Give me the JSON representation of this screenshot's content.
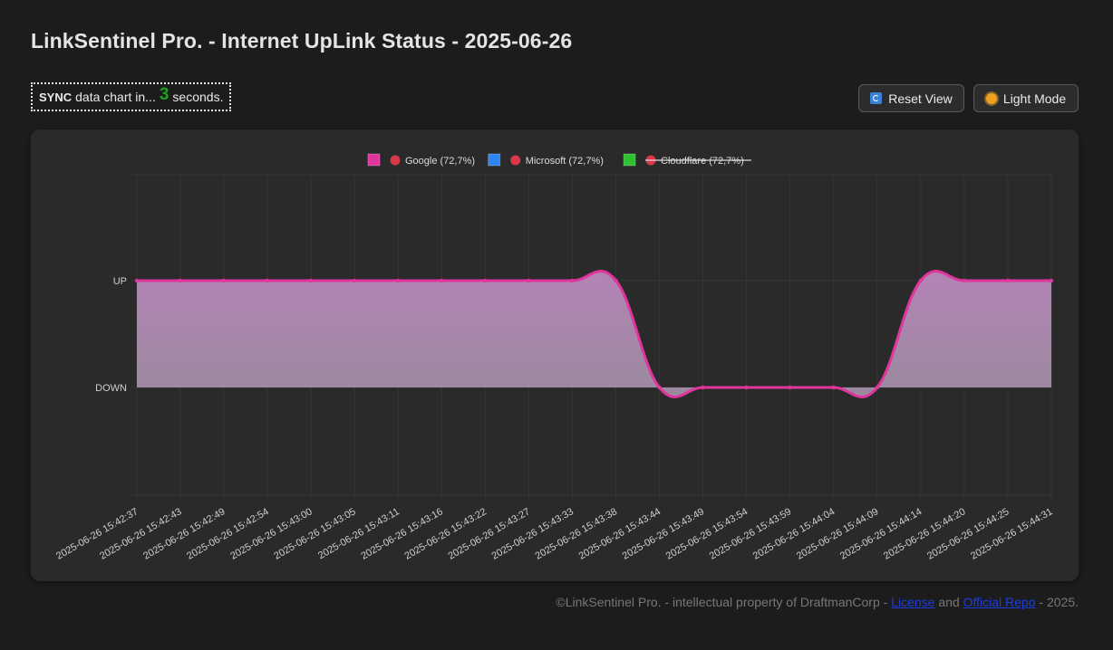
{
  "header": {
    "title": "LinkSentinel Pro. - Internet UpLink Status - 2025-06-26"
  },
  "sync": {
    "prefix": "SYNC",
    "middle": "data chart in...",
    "count": "3",
    "suffix": "seconds."
  },
  "toolbar": {
    "reset_label": "Reset View",
    "reset_icon": "reset-icon",
    "light_label": "Light Mode",
    "light_icon": "sun-icon"
  },
  "chart_data": {
    "type": "line",
    "legend_position": "top",
    "grid": true,
    "y_categories": [
      "DOWN",
      "UP"
    ],
    "x": [
      "2025-06-26 15:42:37",
      "2025-06-26 15:42:43",
      "2025-06-26 15:42:49",
      "2025-06-26 15:42:54",
      "2025-06-26 15:43:00",
      "2025-06-26 15:43:05",
      "2025-06-26 15:43:11",
      "2025-06-26 15:43:16",
      "2025-06-26 15:43:22",
      "2025-06-26 15:43:27",
      "2025-06-26 15:43:33",
      "2025-06-26 15:43:38",
      "2025-06-26 15:43:44",
      "2025-06-26 15:43:49",
      "2025-06-26 15:43:54",
      "2025-06-26 15:43:59",
      "2025-06-26 15:44:04",
      "2025-06-26 15:44:09",
      "2025-06-26 15:44:14",
      "2025-06-26 15:44:20",
      "2025-06-26 15:44:25",
      "2025-06-26 15:44:31"
    ],
    "series": [
      {
        "name": "Google (72,7%)",
        "color": "#e0359c",
        "fill": "#b98cbf",
        "hidden": false,
        "values": [
          1,
          1,
          1,
          1,
          1,
          1,
          1,
          1,
          1,
          1,
          1,
          1,
          0,
          0,
          0,
          0,
          0,
          0,
          1,
          1,
          1,
          1
        ]
      },
      {
        "name": "Microsoft (72,7%)",
        "color": "#2f86f0",
        "hidden": false,
        "values": [
          1,
          1,
          1,
          1,
          1,
          1,
          1,
          1,
          1,
          1,
          1,
          1,
          0,
          0,
          0,
          0,
          0,
          0,
          1,
          1,
          1,
          1
        ]
      },
      {
        "name": "Cloudflare (72,7%)",
        "color": "#2fc02f",
        "hidden": true,
        "values": [
          1,
          1,
          1,
          1,
          1,
          1,
          1,
          1,
          1,
          1,
          1,
          1,
          0,
          0,
          0,
          0,
          0,
          0,
          1,
          1,
          1,
          1
        ]
      }
    ]
  },
  "footer": {
    "text_before": "©LinkSentinel Pro. - intellectual property of DraftmanCorp - ",
    "license_link": "License",
    "and": " and ",
    "repo_link": "Official Repo",
    "text_after": " - 2025."
  }
}
